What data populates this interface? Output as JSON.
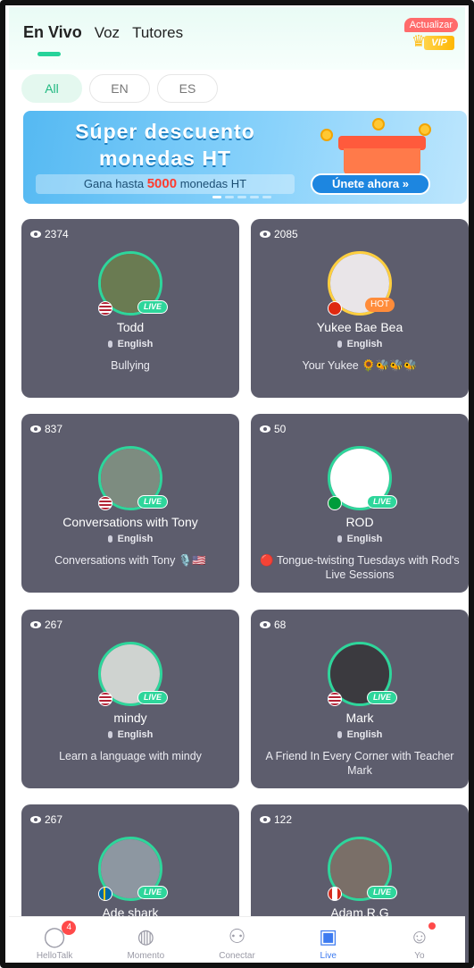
{
  "header": {
    "tabs": [
      {
        "label": "En Vivo",
        "active": true
      },
      {
        "label": "Voz",
        "active": false
      },
      {
        "label": "Tutores",
        "active": false
      }
    ],
    "vip_pill": "Actualizar",
    "vip_label": "VIP"
  },
  "filters": [
    {
      "label": "All",
      "active": true
    },
    {
      "label": "EN",
      "active": false
    },
    {
      "label": "ES",
      "active": false
    }
  ],
  "banner": {
    "title_line1": "Súper descuento",
    "title_line2": "monedas HT",
    "sub_prefix": "Gana hasta",
    "sub_amount": "5000",
    "sub_suffix": "monedas HT",
    "cta": "Únete ahora »"
  },
  "rooms": [
    {
      "viewers": "2374",
      "name": "Todd",
      "language": "English",
      "description": "Bullying",
      "badge": "LIVE",
      "flag": "us",
      "avatar_color": "#6a7b52"
    },
    {
      "viewers": "2085",
      "name": "Yukee Bae Bea",
      "language": "English",
      "description": "Your Yukee 🌻🐝🐝🐝",
      "badge": "HOT",
      "flag": "cn",
      "avatar_color": "#e9e5e8"
    },
    {
      "viewers": "837",
      "name": "Conversations with Tony",
      "language": "English",
      "description": "Conversations with Tony 🎙️🇺🇸",
      "badge": "LIVE",
      "flag": "us",
      "avatar_color": "#7d8c80"
    },
    {
      "viewers": "50",
      "name": "ROD",
      "language": "English",
      "description": "🔴 Tongue-twisting Tuesdays with Rod's Live Sessions",
      "badge": "LIVE",
      "flag": "br",
      "avatar_color": "#ffffff"
    },
    {
      "viewers": "267",
      "name": "mindy",
      "language": "English",
      "description": "Learn a language with mindy",
      "badge": "LIVE",
      "flag": "us",
      "avatar_color": "#cfd3d0"
    },
    {
      "viewers": "68",
      "name": "Mark",
      "language": "English",
      "description": "A Friend In Every Corner with Teacher Mark",
      "badge": "LIVE",
      "flag": "us",
      "avatar_color": "#3b3a3f"
    },
    {
      "viewers": "267",
      "name": "Ade shark",
      "language": "",
      "description": "",
      "badge": "LIVE",
      "flag": "se",
      "avatar_color": "#8d97a1"
    },
    {
      "viewers": "122",
      "name": "Adam.R.G",
      "language": "",
      "description": "",
      "badge": "LIVE",
      "flag": "ca",
      "avatar_color": "#7a6f68"
    }
  ],
  "nav": [
    {
      "label": "HelloTalk",
      "icon": "chat-bubble-icon",
      "glyph": "◯",
      "badge": "4",
      "active": false
    },
    {
      "label": "Momento",
      "icon": "planet-icon",
      "glyph": "◍",
      "badge": "",
      "active": false
    },
    {
      "label": "Conectar",
      "icon": "people-icon",
      "glyph": "⚇",
      "badge": "",
      "active": false
    },
    {
      "label": "Live",
      "icon": "tv-icon",
      "glyph": "▣",
      "badge": "",
      "active": true
    },
    {
      "label": "Yo",
      "icon": "profile-icon",
      "glyph": "☺",
      "badge": "dot",
      "active": false
    }
  ],
  "colors": {
    "accent": "#26d39a",
    "card": "#5d5d6d",
    "nav_active": "#3d7bf0",
    "badge": "#ff4a4a"
  }
}
